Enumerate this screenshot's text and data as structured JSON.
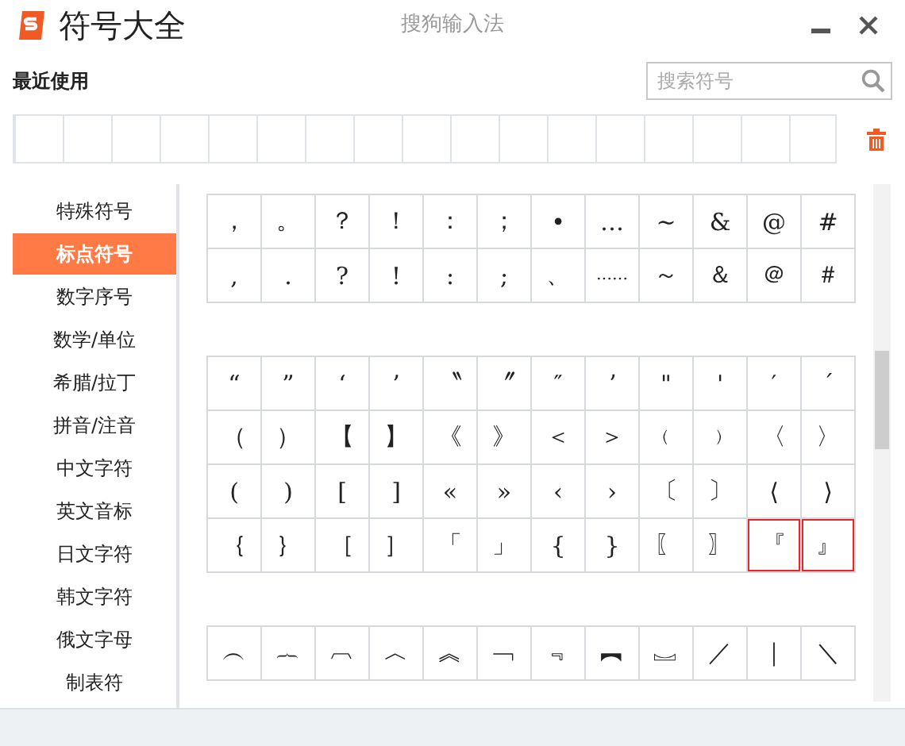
{
  "window": {
    "title": "符号大全",
    "app_name": "搜狗输入法"
  },
  "recent": {
    "label": "最近使用"
  },
  "search": {
    "placeholder": "搜索符号"
  },
  "sidebar": {
    "items": [
      {
        "label": "特殊符号",
        "selected": false
      },
      {
        "label": "标点符号",
        "selected": true
      },
      {
        "label": "数字序号",
        "selected": false
      },
      {
        "label": "数学/单位",
        "selected": false
      },
      {
        "label": "希腊/拉丁",
        "selected": false
      },
      {
        "label": "拼音/注音",
        "selected": false
      },
      {
        "label": "中文字符",
        "selected": false
      },
      {
        "label": "英文音标",
        "selected": false
      },
      {
        "label": "日文字符",
        "selected": false
      },
      {
        "label": "韩文字符",
        "selected": false
      },
      {
        "label": "俄文字母",
        "selected": false
      },
      {
        "label": "制表符",
        "selected": false
      }
    ]
  },
  "symbol_groups": [
    {
      "rows": [
        [
          {
            "symbol": "，",
            "selected": false
          },
          {
            "symbol": "。",
            "selected": false
          },
          {
            "symbol": "？",
            "selected": false
          },
          {
            "symbol": "！",
            "selected": false
          },
          {
            "symbol": "：",
            "selected": false
          },
          {
            "symbol": "；",
            "selected": false
          },
          {
            "symbol": "•",
            "selected": false
          },
          {
            "symbol": "…",
            "selected": false
          },
          {
            "symbol": "~",
            "selected": false
          },
          {
            "symbol": "&",
            "selected": false
          },
          {
            "symbol": "@",
            "selected": false
          },
          {
            "symbol": "#",
            "selected": false
          }
        ],
        [
          {
            "symbol": ",",
            "selected": false
          },
          {
            "symbol": ".",
            "selected": false
          },
          {
            "symbol": "?",
            "selected": false
          },
          {
            "symbol": "!",
            "selected": false
          },
          {
            "symbol": ":",
            "selected": false
          },
          {
            "symbol": ";",
            "selected": false
          },
          {
            "symbol": "、",
            "selected": false
          },
          {
            "symbol": "……",
            "selected": false
          },
          {
            "symbol": "～",
            "selected": false
          },
          {
            "symbol": "＆",
            "selected": false
          },
          {
            "symbol": "＠",
            "selected": false
          },
          {
            "symbol": "＃",
            "selected": false
          }
        ]
      ]
    },
    {
      "rows": [
        [
          {
            "symbol": "“",
            "selected": false
          },
          {
            "symbol": "”",
            "selected": false
          },
          {
            "symbol": "‘",
            "selected": false
          },
          {
            "symbol": "’",
            "selected": false
          },
          {
            "symbol": "〝",
            "selected": false
          },
          {
            "symbol": "〞",
            "selected": false
          },
          {
            "symbol": "″",
            "selected": false
          },
          {
            "symbol": "ʼ",
            "selected": false
          },
          {
            "symbol": "\"",
            "selected": false
          },
          {
            "symbol": "'",
            "selected": false
          },
          {
            "symbol": "′",
            "selected": false
          },
          {
            "symbol": "ˊ",
            "selected": false
          }
        ],
        [
          {
            "symbol": "（",
            "selected": false
          },
          {
            "symbol": "）",
            "selected": false
          },
          {
            "symbol": "【",
            "selected": false
          },
          {
            "symbol": "】",
            "selected": false
          },
          {
            "symbol": "《",
            "selected": false
          },
          {
            "symbol": "》",
            "selected": false
          },
          {
            "symbol": "＜",
            "selected": false
          },
          {
            "symbol": "＞",
            "selected": false
          },
          {
            "symbol": "﹙",
            "selected": false
          },
          {
            "symbol": "﹚",
            "selected": false
          },
          {
            "symbol": "〈",
            "selected": false
          },
          {
            "symbol": "〉",
            "selected": false
          }
        ],
        [
          {
            "symbol": "(",
            "selected": false
          },
          {
            "symbol": ")",
            "selected": false
          },
          {
            "symbol": "[",
            "selected": false
          },
          {
            "symbol": "]",
            "selected": false
          },
          {
            "symbol": "«",
            "selected": false
          },
          {
            "symbol": "»",
            "selected": false
          },
          {
            "symbol": "‹",
            "selected": false
          },
          {
            "symbol": "›",
            "selected": false
          },
          {
            "symbol": "〔",
            "selected": false
          },
          {
            "symbol": "〕",
            "selected": false
          },
          {
            "symbol": "⟨",
            "selected": false
          },
          {
            "symbol": "⟩",
            "selected": false
          }
        ],
        [
          {
            "symbol": "｛",
            "selected": false
          },
          {
            "symbol": "｝",
            "selected": false
          },
          {
            "symbol": "［",
            "selected": false
          },
          {
            "symbol": "］",
            "selected": false
          },
          {
            "symbol": "「",
            "selected": false
          },
          {
            "symbol": "」",
            "selected": false
          },
          {
            "symbol": "{",
            "selected": false
          },
          {
            "symbol": "}",
            "selected": false
          },
          {
            "symbol": "〖",
            "selected": false
          },
          {
            "symbol": "〗",
            "selected": false
          },
          {
            "symbol": "『",
            "selected": true
          },
          {
            "symbol": "』",
            "selected": true
          }
        ]
      ]
    },
    {
      "rows": [
        [
          {
            "symbol": "︵",
            "selected": false
          },
          {
            "symbol": "︷",
            "selected": false
          },
          {
            "symbol": "︹",
            "selected": false
          },
          {
            "symbol": "︿",
            "selected": false
          },
          {
            "symbol": "︽",
            "selected": false
          },
          {
            "symbol": "﹁",
            "selected": false
          },
          {
            "symbol": "﹃",
            "selected": false
          },
          {
            "symbol": "︻",
            "selected": false
          },
          {
            "symbol": "︗",
            "selected": false
          },
          {
            "symbol": "／",
            "selected": false
          },
          {
            "symbol": "｜",
            "selected": false
          },
          {
            "symbol": "＼",
            "selected": false
          }
        ]
      ]
    }
  ]
}
